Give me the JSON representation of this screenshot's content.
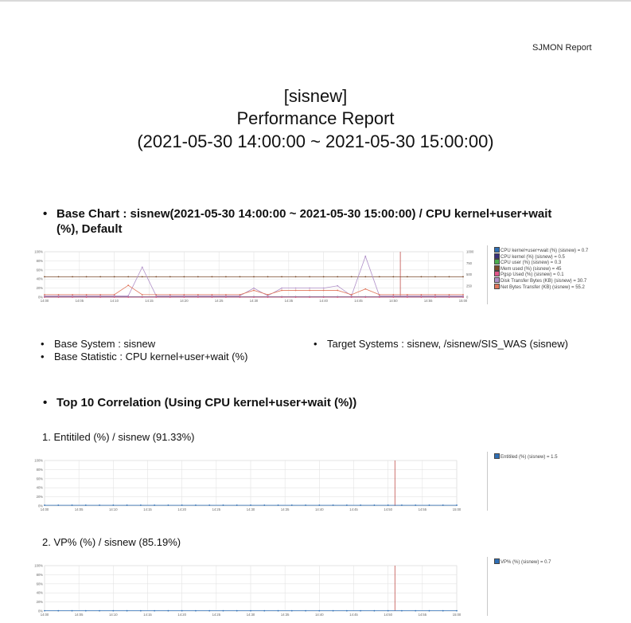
{
  "header": {
    "brand": "SJMON Report",
    "title_line1": "[sisnew]",
    "title_line2": "Performance Report",
    "title_line3": "(2021-05-30 14:00:00 ~ 2021-05-30 15:00:00)"
  },
  "base_section": {
    "heading_line1": "Base Chart : sisnew(2021-05-30 14:00:00 ~ 2021-05-30 15:00:00) / CPU kernel+user+wait",
    "heading_line2": "(%), Default",
    "base_system": "Base System : sisnew",
    "base_statistic": "Base Statistic : CPU kernel+user+wait (%)",
    "target_systems": "Target Systems : sisnew, /sisnew/SIS_WAS (sisnew)"
  },
  "corr_section": {
    "heading": "Top 10 Correlation (Using CPU kernel+user+wait (%))",
    "items": [
      {
        "title": "1. Entitiled (%) / sisnew (91.33%)"
      },
      {
        "title": "2. VP% (%) / sisnew (85.19%)"
      }
    ]
  },
  "chart_data": [
    {
      "type": "line",
      "x": [
        "14:00",
        "14:02",
        "14:04",
        "14:06",
        "14:08",
        "14:10",
        "14:12",
        "14:14",
        "14:16",
        "14:18",
        "14:20",
        "14:22",
        "14:24",
        "14:26",
        "14:28",
        "14:30",
        "14:32",
        "14:34",
        "14:36",
        "14:38",
        "14:40",
        "14:42",
        "14:44",
        "14:46",
        "14:48",
        "14:50",
        "14:52",
        "14:54",
        "14:56",
        "14:58",
        "15:00"
      ],
      "x_tick_labels": [
        "14:00",
        "14:05",
        "14:10",
        "14:15",
        "14:20",
        "14:25",
        "14:30",
        "14:35",
        "14:40",
        "14:45",
        "14:50",
        "14:55",
        "15:00"
      ],
      "y_tick_labels": [
        "0%",
        "20%",
        "40%",
        "60%",
        "80%",
        "100%"
      ],
      "y2_tick_labels": [
        "0",
        "250",
        "500",
        "750",
        "1000"
      ],
      "ylim": [
        0,
        100
      ],
      "y2lim": [
        0,
        1000
      ],
      "marker_x": "14:51",
      "grid": true,
      "legend_position": "right",
      "series": [
        {
          "name": "CPU kernel+user+wait (%) (sisnew) = 0.7",
          "color": "#2f6fb5",
          "axis": "left",
          "values": [
            1,
            1,
            1,
            1,
            1,
            1,
            1,
            1,
            1,
            1,
            1,
            1,
            1,
            1,
            1,
            1,
            1,
            1,
            1,
            1,
            1,
            1,
            1,
            1,
            1,
            1,
            1,
            1,
            1,
            1,
            1
          ]
        },
        {
          "name": "CPU kernel (%) (sisnew) = 0.5",
          "color": "#3a2f7a",
          "axis": "left",
          "values": [
            0.5,
            0.5,
            0.5,
            0.5,
            0.5,
            0.5,
            0.5,
            0.5,
            0.5,
            0.5,
            0.5,
            0.5,
            0.5,
            0.5,
            0.5,
            0.5,
            0.5,
            0.5,
            0.5,
            0.5,
            0.5,
            0.5,
            0.5,
            0.5,
            0.5,
            0.5,
            0.5,
            0.5,
            0.5,
            0.5,
            0.5
          ]
        },
        {
          "name": "CPU user (%) (sisnew) = 0.3",
          "color": "#4caf50",
          "axis": "left",
          "values": [
            0.3,
            0.3,
            0.3,
            0.3,
            0.3,
            0.3,
            0.3,
            0.3,
            0.3,
            0.3,
            0.3,
            0.3,
            0.3,
            0.3,
            0.3,
            0.3,
            0.3,
            0.3,
            0.3,
            0.3,
            0.3,
            0.3,
            0.3,
            0.3,
            0.3,
            0.3,
            0.3,
            0.3,
            0.3,
            0.3,
            0.3
          ]
        },
        {
          "name": "Mem used (%) (sisnew) = 45",
          "color": "#7a4a2a",
          "axis": "left",
          "values": [
            45,
            45,
            45,
            45,
            45,
            45,
            45,
            45,
            45,
            45,
            45,
            45,
            45,
            45,
            45,
            45,
            45,
            45,
            45,
            45,
            45,
            45,
            45,
            45,
            45,
            45,
            45,
            45,
            45,
            45,
            45
          ]
        },
        {
          "name": "Pgsp Used (%) (sisnew) = 0.1",
          "color": "#e0558a",
          "axis": "left",
          "values": [
            0.1,
            0.1,
            0.1,
            0.1,
            0.1,
            0.1,
            0.1,
            0.1,
            0.1,
            0.1,
            0.1,
            0.1,
            0.1,
            0.1,
            0.1,
            0.1,
            0.1,
            0.1,
            0.1,
            0.1,
            0.1,
            0.1,
            0.1,
            0.1,
            0.1,
            0.1,
            0.1,
            0.1,
            0.1,
            0.1,
            0.1
          ]
        },
        {
          "name": "Disk Transfer Bytes (KB) (sisnew) = 30.7",
          "color": "#b090c8",
          "axis": "right",
          "values": [
            30,
            30,
            30,
            30,
            30,
            30,
            30,
            660,
            30,
            30,
            30,
            30,
            30,
            30,
            30,
            200,
            30,
            200,
            200,
            200,
            200,
            250,
            30,
            900,
            30,
            30,
            30,
            30,
            30,
            30,
            30
          ]
        },
        {
          "name": "Net Bytes Transfer (KB) (sisnew) = 55.2",
          "color": "#e0755a",
          "axis": "right",
          "values": [
            55,
            55,
            55,
            55,
            55,
            55,
            260,
            55,
            55,
            55,
            55,
            55,
            55,
            55,
            55,
            150,
            55,
            150,
            150,
            150,
            150,
            150,
            55,
            180,
            55,
            55,
            55,
            55,
            55,
            55,
            55
          ]
        }
      ]
    },
    {
      "type": "line",
      "x": [
        "14:00",
        "14:02",
        "14:04",
        "14:06",
        "14:08",
        "14:10",
        "14:12",
        "14:14",
        "14:16",
        "14:18",
        "14:20",
        "14:22",
        "14:24",
        "14:26",
        "14:28",
        "14:30",
        "14:32",
        "14:34",
        "14:36",
        "14:38",
        "14:40",
        "14:42",
        "14:44",
        "14:46",
        "14:48",
        "14:50",
        "14:52",
        "14:54",
        "14:56",
        "14:58",
        "15:00"
      ],
      "x_tick_labels": [
        "14:00",
        "14:05",
        "14:10",
        "14:15",
        "14:20",
        "14:25",
        "14:30",
        "14:35",
        "14:40",
        "14:45",
        "14:50",
        "14:55",
        "15:00"
      ],
      "y_tick_labels": [
        "0%",
        "20%",
        "40%",
        "60%",
        "80%",
        "100%"
      ],
      "ylim": [
        0,
        100
      ],
      "marker_x": "14:51",
      "grid": true,
      "legend_position": "right",
      "series": [
        {
          "name": "Entitiled (%) (sisnew) = 1.5",
          "color": "#2f6fb5",
          "axis": "left",
          "values": [
            1.5,
            1.5,
            1.5,
            1.5,
            1.5,
            1.5,
            1.5,
            1.5,
            1.5,
            1.5,
            1.5,
            1.5,
            1.5,
            1.5,
            1.5,
            1.5,
            1.5,
            1.5,
            1.5,
            1.5,
            1.5,
            1.5,
            1.5,
            1.5,
            1.5,
            1.5,
            1.5,
            1.5,
            1.5,
            1.5,
            1.5
          ]
        }
      ]
    },
    {
      "type": "line",
      "x": [
        "14:00",
        "14:02",
        "14:04",
        "14:06",
        "14:08",
        "14:10",
        "14:12",
        "14:14",
        "14:16",
        "14:18",
        "14:20",
        "14:22",
        "14:24",
        "14:26",
        "14:28",
        "14:30",
        "14:32",
        "14:34",
        "14:36",
        "14:38",
        "14:40",
        "14:42",
        "14:44",
        "14:46",
        "14:48",
        "14:50",
        "14:52",
        "14:54",
        "14:56",
        "14:58",
        "15:00"
      ],
      "x_tick_labels": [
        "14:00",
        "14:05",
        "14:10",
        "14:15",
        "14:20",
        "14:25",
        "14:30",
        "14:35",
        "14:40",
        "14:45",
        "14:50",
        "14:55",
        "15:00"
      ],
      "y_tick_labels": [
        "0%",
        "20%",
        "40%",
        "60%",
        "80%",
        "100%"
      ],
      "ylim": [
        0,
        100
      ],
      "marker_x": "14:51",
      "grid": true,
      "legend_position": "right",
      "series": [
        {
          "name": "VP% (%) (sisnew) = 0.7",
          "color": "#2f6fb5",
          "axis": "left",
          "values": [
            0.7,
            0.7,
            0.7,
            0.7,
            0.7,
            0.7,
            0.7,
            0.7,
            0.7,
            0.7,
            0.7,
            0.7,
            0.7,
            0.7,
            0.7,
            0.7,
            0.7,
            0.7,
            0.7,
            0.7,
            0.7,
            0.7,
            0.7,
            0.7,
            0.7,
            0.7,
            0.7,
            0.7,
            0.7,
            0.7,
            0.7
          ]
        }
      ]
    }
  ]
}
